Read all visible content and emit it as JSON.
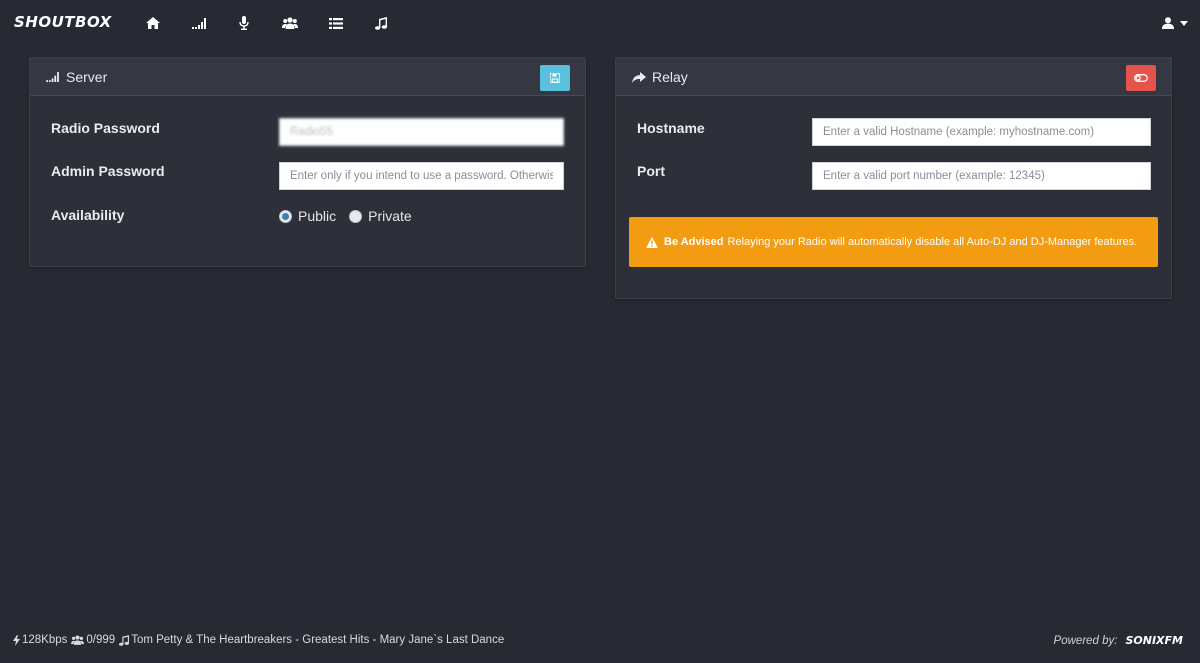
{
  "app": {
    "brand": "SHOUTBOX"
  },
  "nav": {
    "icons": [
      "home-icon",
      "signal-icon",
      "microphone-icon",
      "users-icon",
      "list-icon",
      "music-icon"
    ]
  },
  "user_menu": {
    "icon": "user-icon",
    "caret": "caret-down-icon"
  },
  "server_panel": {
    "title": "Server",
    "icon": "signal-icon",
    "save_button_icon": "save-icon",
    "save_button_color": "#5bc0de",
    "fields": {
      "radio_password": {
        "label": "Radio Password",
        "value": "Radio55"
      },
      "admin_password": {
        "label": "Admin Password",
        "placeholder": "Enter only if you intend to use a password. Otherwise, leave blank."
      },
      "availability": {
        "label": "Availability",
        "options": [
          "Public",
          "Private"
        ],
        "selected": "Public"
      }
    }
  },
  "relay_panel": {
    "title": "Relay",
    "icon": "share-icon",
    "toggle_button_icon": "toggle-icon",
    "toggle_button_color": "#e5534b",
    "fields": {
      "hostname": {
        "label": "Hostname",
        "placeholder": "Enter a valid Hostname (example: myhostname.com)"
      },
      "port": {
        "label": "Port",
        "placeholder": "Enter a valid port number (example: 12345)"
      }
    },
    "alert": {
      "icon": "warning-icon",
      "strong": "Be Advised",
      "text": "Relaying your Radio will automatically disable all Auto-DJ and DJ-Manager features.",
      "color": "#f39c12"
    }
  },
  "footer": {
    "bitrate": "128Kbps",
    "listeners": "0/999",
    "now_playing": "Tom Petty & The Heartbreakers - Greatest Hits - Mary Jane`s Last Dance",
    "powered_label": "Powered by:",
    "powered_brand": "SONIXFM"
  },
  "colors": {
    "background": "#272a33",
    "panel": "#2d3039",
    "panel_heading": "#353842"
  }
}
